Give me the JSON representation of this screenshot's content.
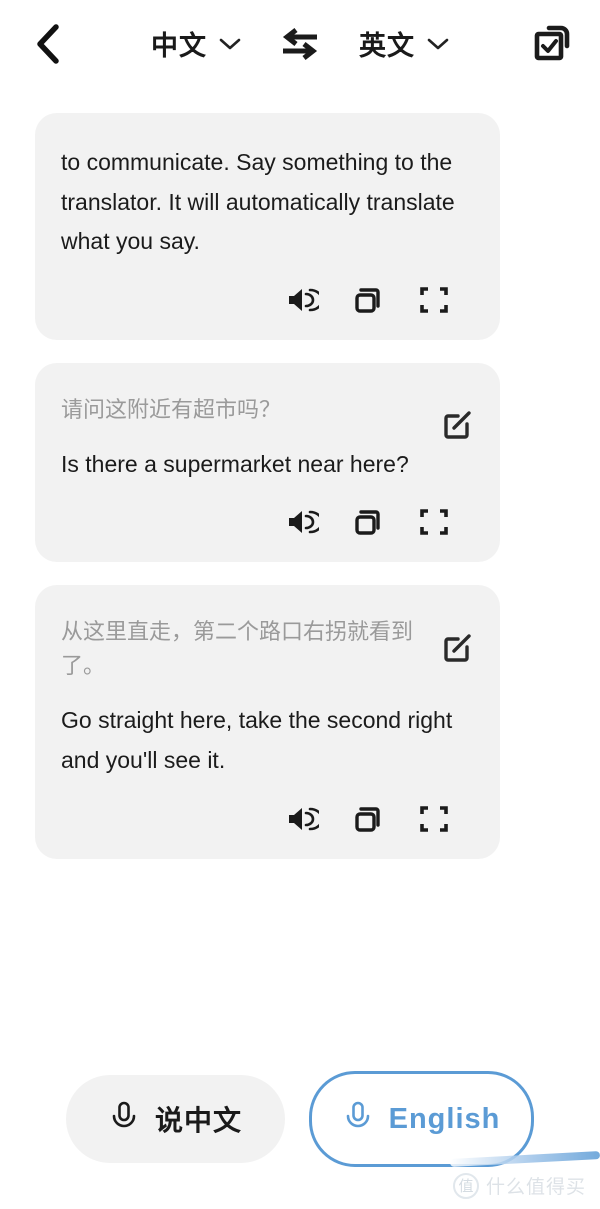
{
  "header": {
    "back_icon": "chevron-left-icon",
    "source_language": "中文",
    "target_language": "英文",
    "swap_icon": "swap-arrows-icon",
    "dropdown_icon": "chevron-down-icon",
    "select_icon": "checkbox-multi-select-icon"
  },
  "cards": [
    {
      "source_text": "",
      "target_text": "to communicate. Say something to the translator. It will automatically translate what you say.",
      "has_edit": false,
      "actions": [
        "speaker-icon",
        "copy-icon",
        "fullscreen-icon"
      ]
    },
    {
      "source_text": "请问这附近有超市吗？",
      "target_text": "Is there a supermarket near here?",
      "has_edit": true,
      "edit_icon": "edit-icon",
      "actions": [
        "speaker-icon",
        "copy-icon",
        "fullscreen-icon"
      ]
    },
    {
      "source_text": "从这里直走，第二个路口右拐就看到了。",
      "target_text": "Go straight here, take the second right and you'll see it.",
      "has_edit": true,
      "edit_icon": "edit-icon",
      "actions": [
        "speaker-icon",
        "copy-icon",
        "fullscreen-icon"
      ]
    }
  ],
  "bottom": {
    "left_button_label": "说中文",
    "right_button_label": "English",
    "mic_icon": "microphone-icon",
    "accent_color": "#5b9bd5",
    "inactive_bg": "#f2f2f2"
  },
  "watermark": {
    "badge": "值",
    "text": "什么值得买"
  }
}
